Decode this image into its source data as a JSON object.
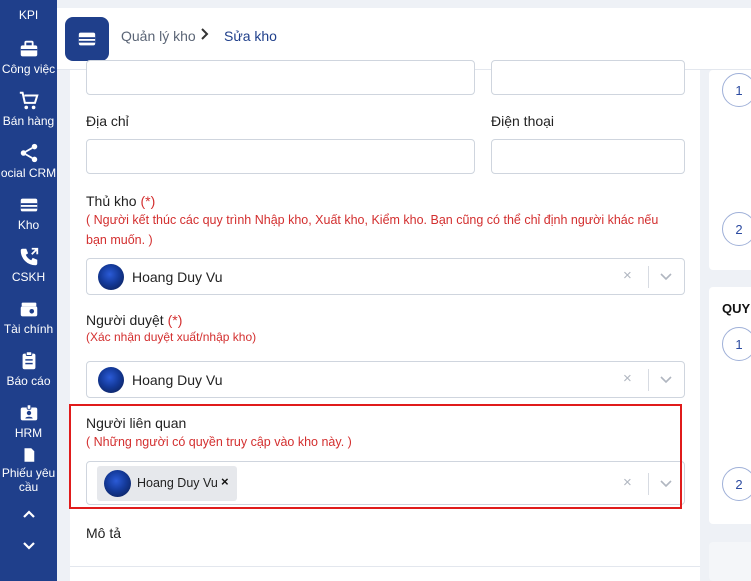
{
  "sidebar": {
    "items": [
      {
        "label": "KPI",
        "icon": "kpi-icon"
      },
      {
        "label": "Công việc",
        "icon": "briefcase-icon"
      },
      {
        "label": "Bán hàng",
        "icon": "cart-icon"
      },
      {
        "label": "ocial CRM",
        "icon": "share-icon"
      },
      {
        "label": "Kho",
        "icon": "warehouse-icon"
      },
      {
        "label": "CSKH",
        "icon": "phone-icon"
      },
      {
        "label": "Tài chính",
        "icon": "finance-icon"
      },
      {
        "label": "Báo cáo",
        "icon": "clipboard-icon"
      },
      {
        "label": "HRM",
        "icon": "id-badge-icon"
      },
      {
        "label": "Phiếu yêu",
        "label2": "cầu",
        "icon": "document-icon"
      }
    ]
  },
  "header": {
    "breadcrumb_parent": "Quản lý kho",
    "breadcrumb_sep": "›",
    "breadcrumb_current": "Sửa kho"
  },
  "form": {
    "address_label": "Địa chỉ",
    "address_value": "",
    "phone_label": "Điện thoại",
    "phone_value": "",
    "keeper_label": "Thủ kho",
    "keeper_req": "(*)",
    "keeper_hint_line1": "( Người kết thúc các quy trình Nhập kho, Xuất kho, Kiểm kho. Bạn cũng có thể chỉ định người khác nếu",
    "keeper_hint_line2": "bạn muốn. )",
    "keeper_value": "Hoang Duy Vu",
    "approver_label": "Người duyệt",
    "approver_req": "(*)",
    "approver_hint": "(Xác nhận duyệt xuất/nhập kho)",
    "approver_value": "Hoang Duy Vu",
    "related_label": "Người liên quan",
    "related_hint": "( Những người có quyền truy cập vào kho này. )",
    "related_chip": "Hoang Duy Vu",
    "related_chip_remove": "×",
    "description_label": "Mô tả",
    "clear_symbol": "×"
  },
  "right_panel": {
    "steps_top": [
      "1",
      "2"
    ],
    "heading": "QUY",
    "steps_bottom": [
      "1",
      "2"
    ]
  },
  "colors": {
    "sidebar": "#1f3f8b",
    "accent": "#1f3f8b",
    "required": "#d32f2f",
    "highlight_border": "#e01b1b"
  }
}
